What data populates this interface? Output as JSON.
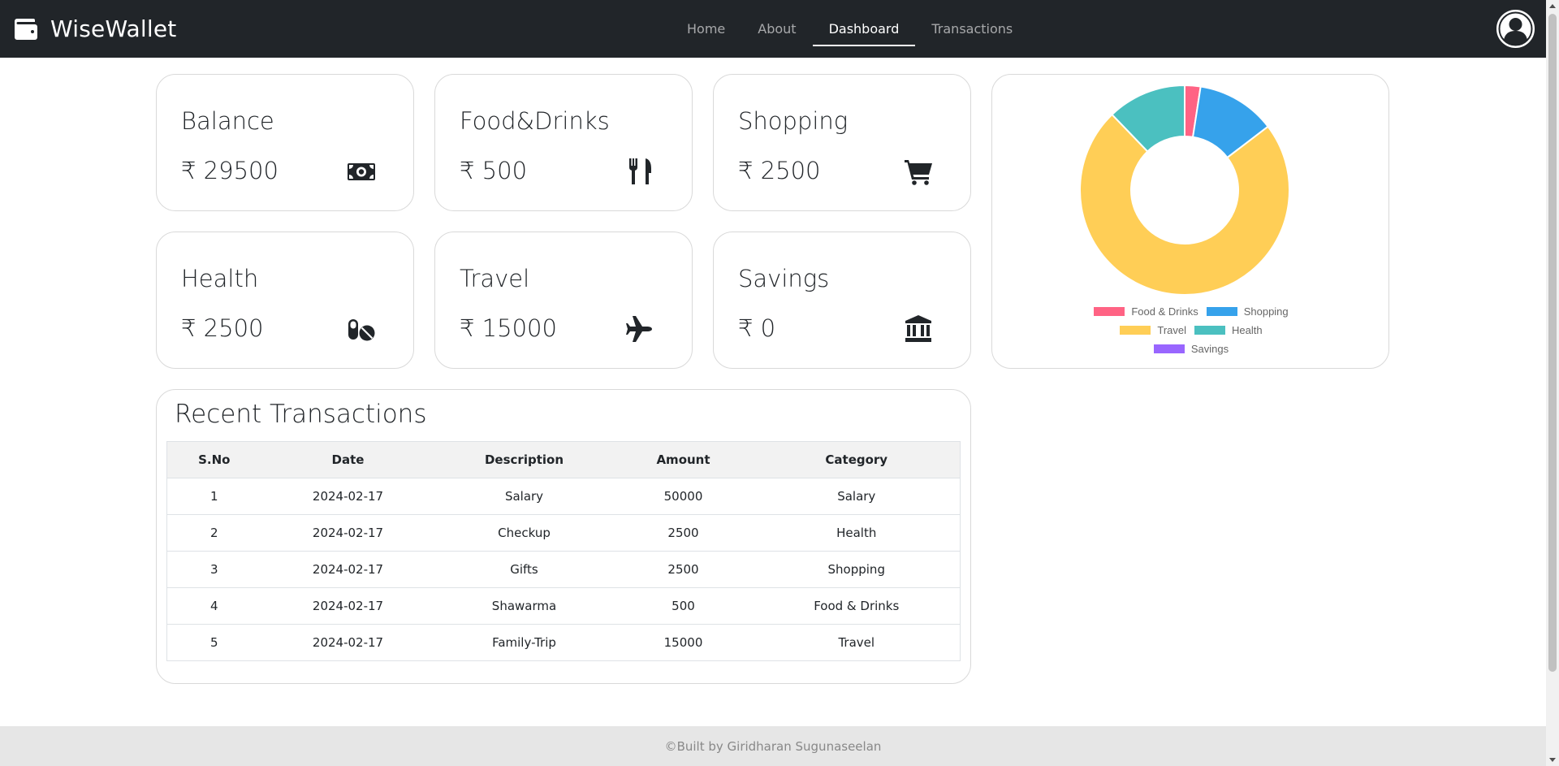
{
  "brand": {
    "name": "WiseWallet"
  },
  "nav": {
    "items": [
      {
        "label": "Home",
        "active": false
      },
      {
        "label": "About",
        "active": false
      },
      {
        "label": "Dashboard",
        "active": true
      },
      {
        "label": "Transactions",
        "active": false
      }
    ]
  },
  "cards": [
    {
      "title": "Balance",
      "amount": "₹ 29500",
      "icon": "money-bill-icon"
    },
    {
      "title": "Food&Drinks",
      "amount": "₹ 500",
      "icon": "utensils-icon"
    },
    {
      "title": "Shopping",
      "amount": "₹ 2500",
      "icon": "shopping-cart-icon"
    },
    {
      "title": "Health",
      "amount": "₹ 2500",
      "icon": "pills-icon"
    },
    {
      "title": "Travel",
      "amount": "₹ 15000",
      "icon": "plane-icon"
    },
    {
      "title": "Savings",
      "amount": "₹ 0",
      "icon": "bank-icon"
    }
  ],
  "chart_data": {
    "type": "pie",
    "variant": "doughnut",
    "categories": [
      "Food & Drinks",
      "Shopping",
      "Travel",
      "Health",
      "Savings"
    ],
    "values": [
      500,
      2500,
      15000,
      2500,
      0
    ],
    "colors": [
      "#ff6384",
      "#36a2eb",
      "#ffce56",
      "#4bc0c0",
      "#9966ff"
    ],
    "legend": "bottom"
  },
  "transactions": {
    "title": "Recent Transactions",
    "columns": [
      "S.No",
      "Date",
      "Description",
      "Amount",
      "Category"
    ],
    "rows": [
      [
        "1",
        "2024-02-17",
        "Salary",
        "50000",
        "Salary"
      ],
      [
        "2",
        "2024-02-17",
        "Checkup",
        "2500",
        "Health"
      ],
      [
        "3",
        "2024-02-17",
        "Gifts",
        "2500",
        "Shopping"
      ],
      [
        "4",
        "2024-02-17",
        "Shawarma",
        "500",
        "Food & Drinks"
      ],
      [
        "5",
        "2024-02-17",
        "Family-Trip",
        "15000",
        "Travel"
      ]
    ]
  },
  "footer": {
    "text": "©Built by Giridharan Sugunaseelan"
  }
}
